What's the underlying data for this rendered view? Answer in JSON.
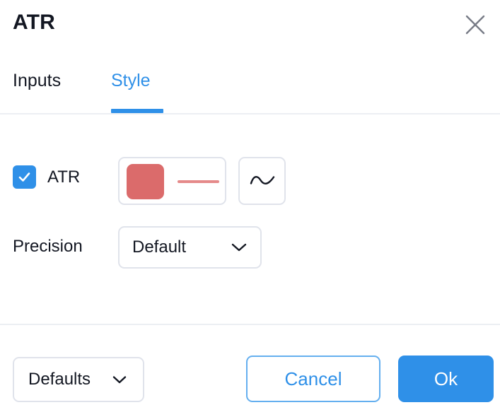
{
  "dialog": {
    "title": "ATR",
    "close_icon": "close-icon"
  },
  "tabs": [
    {
      "label": "Inputs",
      "active": false
    },
    {
      "label": "Style",
      "active": true
    }
  ],
  "style_tab": {
    "rows": [
      {
        "checkbox_checked": true,
        "label": "ATR",
        "color": "#DB6B6B",
        "line_color": "#E58A8A",
        "line_style_icon": "wave-line-icon"
      }
    ],
    "precision": {
      "label": "Precision",
      "value": "Default",
      "chevron_icon": "chevron-down-icon"
    }
  },
  "footer": {
    "defaults_label": "Defaults",
    "defaults_chevron_icon": "chevron-down-icon",
    "cancel_label": "Cancel",
    "ok_label": "Ok"
  },
  "colors": {
    "accent": "#2F90E8",
    "series": "#DB6B6B",
    "border": "#E0E3EB",
    "divider": "#ECEFF3",
    "text": "#131722"
  }
}
